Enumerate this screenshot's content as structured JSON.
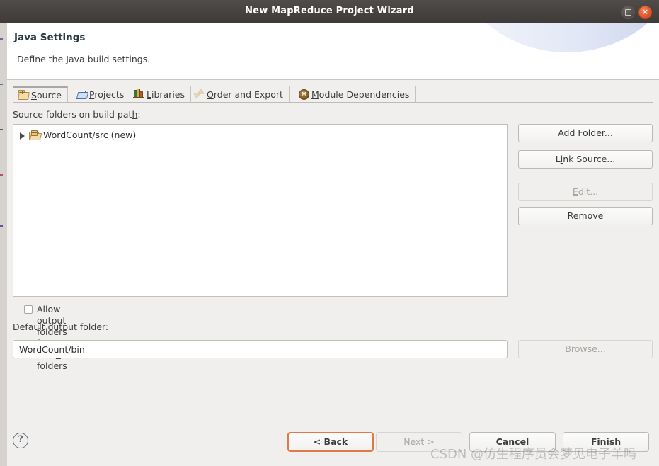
{
  "titlebar": {
    "title": "New MapReduce Project Wizard",
    "maximize_icon": "maximize-icon",
    "close_icon": "close-icon",
    "close_glyph": "×"
  },
  "header": {
    "title": "Java Settings",
    "subtitle": "Define the Java build settings."
  },
  "tabs": [
    {
      "label": "Source",
      "mnemonic": "S",
      "icon": "package-icon",
      "active": true
    },
    {
      "label": "Projects",
      "mnemonic": "P",
      "icon": "folder-open-icon",
      "active": false
    },
    {
      "label": "Libraries",
      "mnemonic": "L",
      "icon": "books-icon",
      "active": false
    },
    {
      "label": "Order and Export",
      "mnemonic": "O",
      "icon": "order-arrows-icon",
      "active": false
    },
    {
      "label": "Module Dependencies",
      "mnemonic": "M",
      "icon": "module-icon",
      "active": false
    }
  ],
  "source_panel": {
    "list_label_pre": "Source folders on build pat",
    "list_label_mnemonic": "h",
    "list_label_post": ":",
    "tree_items": [
      {
        "label": "WordCount/src (new)",
        "icon": "source-folder-icon",
        "expandable": true,
        "expanded": false
      }
    ],
    "buttons": [
      {
        "pre": "A",
        "mnemonic": "d",
        "post": "d Folder...",
        "full": "Add Folder...",
        "enabled": true
      },
      {
        "pre": "L",
        "mnemonic": "i",
        "post": "nk Source...",
        "full": "Link Source...",
        "enabled": true
      },
      {
        "pre": "",
        "mnemonic": "E",
        "post": "dit...",
        "full": "Edit...",
        "enabled": false
      },
      {
        "pre": "",
        "mnemonic": "R",
        "post": "emove",
        "full": "Remove",
        "enabled": true
      }
    ]
  },
  "allow_output": {
    "label_pre": "Allow output folders for sour",
    "label_mnemonic": "c",
    "label_post": "e folders",
    "checked": false
  },
  "output_folder": {
    "label_pre": "Defaul",
    "label_mnemonic": "t",
    "label_post": " output folder:",
    "value": "WordCount/bin",
    "placeholder": "",
    "browse": {
      "pre": "Bro",
      "mnemonic": "w",
      "post": "se...",
      "full": "Browse...",
      "enabled": false
    }
  },
  "footer": {
    "help_icon": "help-icon",
    "help_glyph": "?",
    "buttons": [
      {
        "label": "< Back",
        "enabled": true,
        "focused": true,
        "bold": false
      },
      {
        "label": "Next >",
        "enabled": false,
        "focused": false,
        "bold": false
      },
      {
        "label": "Cancel",
        "enabled": true,
        "focused": false,
        "bold": true
      },
      {
        "label": "Finish",
        "enabled": true,
        "focused": false,
        "bold": true
      }
    ]
  },
  "watermark": {
    "text": "CSDN @仿生程序员会梦见电子羊吗"
  },
  "colors": {
    "titlebar": "#474340",
    "dialog_bg": "#f0efee",
    "field_bg": "#ffffff",
    "focus_orange": "#e07a47",
    "close_red": "#db4b22"
  }
}
